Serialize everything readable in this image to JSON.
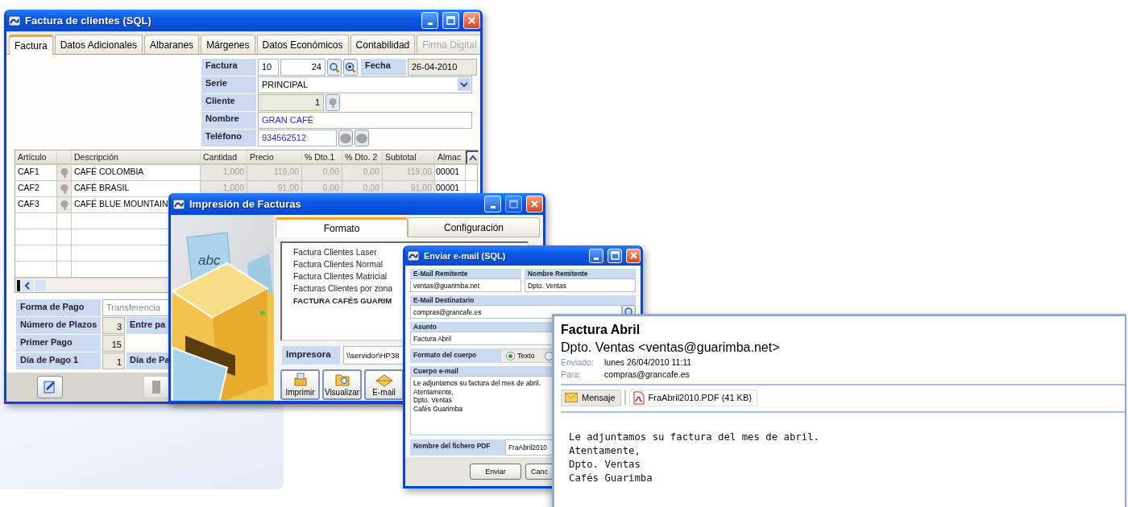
{
  "invoice_window": {
    "title": "Factura de clientes (SQL)",
    "tabs": [
      {
        "label": "Factura",
        "selected": true,
        "disabled": false
      },
      {
        "label": "Datos Adicionales",
        "selected": false,
        "disabled": false
      },
      {
        "label": "Albaranes",
        "selected": false,
        "disabled": false
      },
      {
        "label": "Márgenes",
        "selected": false,
        "disabled": false
      },
      {
        "label": "Datos Económicos",
        "selected": false,
        "disabled": false
      },
      {
        "label": "Contabilidad",
        "selected": false,
        "disabled": false
      },
      {
        "label": "Firma Digital",
        "selected": false,
        "disabled": true
      }
    ],
    "header": {
      "factura_label": "Factura",
      "series_number": "10",
      "number": "24",
      "fecha_label": "Fecha",
      "fecha": "26-04-2010",
      "serie_label": "Serie",
      "serie": "PRINCIPAL",
      "cliente_label": "Cliente",
      "cliente": "1",
      "nombre_label": "Nombre",
      "nombre": "GRAN CAFÉ",
      "telefono_label": "Teléfono",
      "telefono": "934562512"
    },
    "lines": {
      "columns": [
        "Artículo",
        "Descripción",
        "Cantidad",
        "Precio",
        "% Dto.1",
        "% Dto. 2",
        "Subtotal",
        "Almac"
      ],
      "rows": [
        {
          "articulo": "CAF1",
          "descripcion": "CAFÉ COLOMBIA",
          "cantidad": "1,000",
          "precio": "119,00",
          "dto1": "0,00",
          "dto2": "0,00",
          "subtotal": "119,00",
          "almacen": "00001"
        },
        {
          "articulo": "CAF2",
          "descripcion": "CAFÉ BRASIL",
          "cantidad": "1,000",
          "precio": "91,00",
          "dto1": "0,00",
          "dto2": "0,00",
          "subtotal": "91,00",
          "almacen": "00001"
        },
        {
          "articulo": "CAF3",
          "descripcion": "CAFÉ BLUE MOUNTAIN"
        }
      ]
    },
    "payment_method": {
      "label": "Forma de Pago",
      "value": "Transferencia"
    },
    "payment": [
      {
        "label": "Número de Plazos",
        "value": "3",
        "extra_label": "Entre pa"
      },
      {
        "label": "Primer Pago",
        "value": "15"
      },
      {
        "label": "Día de Pago 1",
        "value": "1",
        "extra_label": "Día de Pa"
      }
    ]
  },
  "print_window": {
    "title": "Impresión de Facturas",
    "illustration_text": "abc",
    "tabs": [
      {
        "label": "Formato",
        "selected": true
      },
      {
        "label": "Configuración",
        "selected": false
      }
    ],
    "formats": [
      {
        "label": "Factura Clientes Laser",
        "selected": false
      },
      {
        "label": "Factura Clientes Normal",
        "selected": false
      },
      {
        "label": "Factura Clientes Matricial",
        "selected": false
      },
      {
        "label": "Facturas Clientes por zona",
        "selected": false
      },
      {
        "label": "FACTURA CAFÉS GUARIM",
        "selected": true
      }
    ],
    "printer_label": "Impresora",
    "printer": "\\\\servidor\\HP38",
    "buttons": [
      {
        "label": "Imprimir",
        "kind": "print"
      },
      {
        "label": "Visualizar",
        "kind": "preview"
      },
      {
        "label": "E-mail",
        "kind": "email"
      }
    ]
  },
  "email_window": {
    "title": "Enviar e-mail (SQL)",
    "sender_email_label": "E-Mail Remitente",
    "sender_email": "ventas@guarimba.net",
    "sender_name_label": "Nombre Remitente",
    "sender_name": "Dpto. Ventas",
    "recipient_label": "E-Mail Destinatario",
    "recipient": "compras@grancafe.es",
    "subject_label": "Asunto",
    "subject": "Factura Abril",
    "body_format_label": "Formato del cuerpo",
    "body_formats": [
      {
        "label": "Texto",
        "selected": true
      },
      {
        "selected": false
      }
    ],
    "body_label": "Cuerpo e-mail",
    "body": [
      "Le adjuntamos su factura del mes de abril.",
      "Atentamente,",
      "Dpto. Ventas",
      "Cafés Guarimba"
    ],
    "pdf_name_label": "Nombre del fichero PDF",
    "pdf_name": "FraAbril2010",
    "buttons": [
      "Enviar",
      "Canc"
    ]
  },
  "message_preview": {
    "subject": "Factura Abril",
    "from": "Dpto. Ventas <ventas@guarimba.net>",
    "sent_label": "Enviado:",
    "sent": "lunes 26/04/2010 11:11",
    "to_label": "Para:",
    "to": "compras@grancafe.es",
    "attachments": [
      {
        "label": "Mensaje",
        "kind": "message",
        "selected": true
      },
      {
        "label": "FraAbril2010.PDF (41 KB)",
        "kind": "pdf",
        "selected": false
      }
    ],
    "body": [
      "Le adjuntamos su factura del mes de abril.",
      "Atentamente,",
      "Dpto. Ventas",
      "Cafés Guarimba"
    ]
  }
}
